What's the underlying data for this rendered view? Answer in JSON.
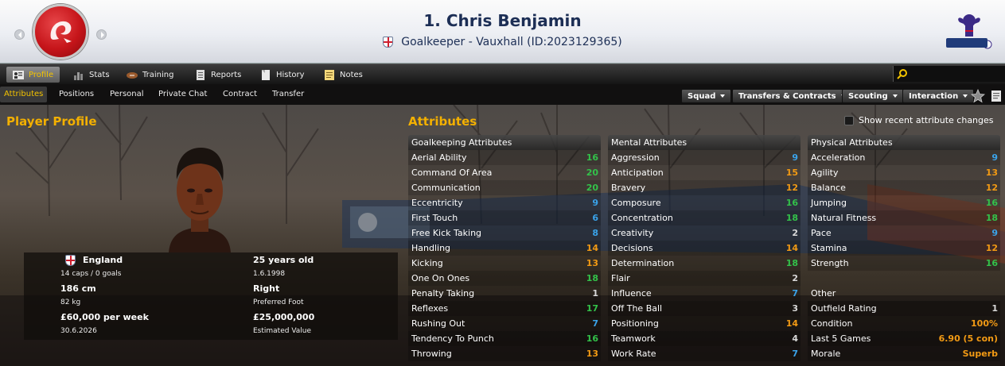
{
  "header": {
    "title": "1. Chris Benjamin",
    "subtitle": "Goalkeeper - Vauxhall (ID:2023129365)"
  },
  "main_tabs": [
    {
      "label": "Profile",
      "icon": "profile-icon",
      "active": true
    },
    {
      "label": "Stats",
      "icon": "stats-icon",
      "active": false
    },
    {
      "label": "Training",
      "icon": "training-icon",
      "active": false
    },
    {
      "label": "Reports",
      "icon": "reports-icon",
      "active": false
    },
    {
      "label": "History",
      "icon": "history-icon",
      "active": false
    },
    {
      "label": "Notes",
      "icon": "notes-icon",
      "active": false
    }
  ],
  "sub_tabs": [
    {
      "label": "Attributes",
      "active": true
    },
    {
      "label": "Positions",
      "active": false
    },
    {
      "label": "Personal",
      "active": false
    },
    {
      "label": "Private Chat",
      "active": false
    },
    {
      "label": "Contract",
      "active": false
    },
    {
      "label": "Transfer",
      "active": false
    }
  ],
  "actions": [
    "Squad",
    "Transfers & Contracts",
    "Scouting",
    "Interaction"
  ],
  "profile": {
    "heading": "Player Profile",
    "nation": "England",
    "caps": "14 caps / 0 goals",
    "height": "186 cm",
    "weight": "82 kg",
    "wage": "£60,000 per week",
    "contract_end": "30.6.2026",
    "age": "25 years old",
    "dob": "1.6.1998",
    "foot": "Right",
    "foot_label": "Preferred Foot",
    "value": "£25,000,000",
    "value_label": "Estimated Value"
  },
  "attributes": {
    "heading": "Attributes",
    "show_changes_label": "Show recent attribute changes",
    "goalkeeping": {
      "title": "Goalkeeping Attributes",
      "rows": [
        {
          "name": "Aerial Ability",
          "value": "16"
        },
        {
          "name": "Command Of Area",
          "value": "20"
        },
        {
          "name": "Communication",
          "value": "20"
        },
        {
          "name": "Eccentricity",
          "value": "9"
        },
        {
          "name": "First Touch",
          "value": "6"
        },
        {
          "name": "Free Kick Taking",
          "value": "8"
        },
        {
          "name": "Handling",
          "value": "14"
        },
        {
          "name": "Kicking",
          "value": "13"
        },
        {
          "name": "One On Ones",
          "value": "18"
        },
        {
          "name": "Penalty Taking",
          "value": "1"
        },
        {
          "name": "Reflexes",
          "value": "17"
        },
        {
          "name": "Rushing Out",
          "value": "7"
        },
        {
          "name": "Tendency To Punch",
          "value": "16"
        },
        {
          "name": "Throwing",
          "value": "13"
        }
      ]
    },
    "mental": {
      "title": "Mental Attributes",
      "rows": [
        {
          "name": "Aggression",
          "value": "9"
        },
        {
          "name": "Anticipation",
          "value": "15"
        },
        {
          "name": "Bravery",
          "value": "12"
        },
        {
          "name": "Composure",
          "value": "16"
        },
        {
          "name": "Concentration",
          "value": "18"
        },
        {
          "name": "Creativity",
          "value": "2"
        },
        {
          "name": "Decisions",
          "value": "14"
        },
        {
          "name": "Determination",
          "value": "18"
        },
        {
          "name": "Flair",
          "value": "2"
        },
        {
          "name": "Influence",
          "value": "7"
        },
        {
          "name": "Off The Ball",
          "value": "3"
        },
        {
          "name": "Positioning",
          "value": "14"
        },
        {
          "name": "Teamwork",
          "value": "4"
        },
        {
          "name": "Work Rate",
          "value": "7"
        }
      ]
    },
    "physical": {
      "title": "Physical Attributes",
      "rows": [
        {
          "name": "Acceleration",
          "value": "9"
        },
        {
          "name": "Agility",
          "value": "13"
        },
        {
          "name": "Balance",
          "value": "12"
        },
        {
          "name": "Jumping",
          "value": "16"
        },
        {
          "name": "Natural Fitness",
          "value": "18"
        },
        {
          "name": "Pace",
          "value": "9"
        },
        {
          "name": "Stamina",
          "value": "12"
        },
        {
          "name": "Strength",
          "value": "16"
        }
      ]
    },
    "other": {
      "title": "Other",
      "rows": [
        {
          "name": "Outfield Rating",
          "value": "1"
        },
        {
          "name": "Condition",
          "value": "100%"
        },
        {
          "name": "Last 5 Games",
          "value": "6.90 (5 con)"
        },
        {
          "name": "Morale",
          "value": "Superb"
        }
      ]
    }
  },
  "colors": {
    "gold": "#f3b000",
    "value_low": "#d9d9d9",
    "value_blue": "#3aa3ea",
    "value_orange": "#f29a14",
    "value_green": "#33c24a"
  }
}
